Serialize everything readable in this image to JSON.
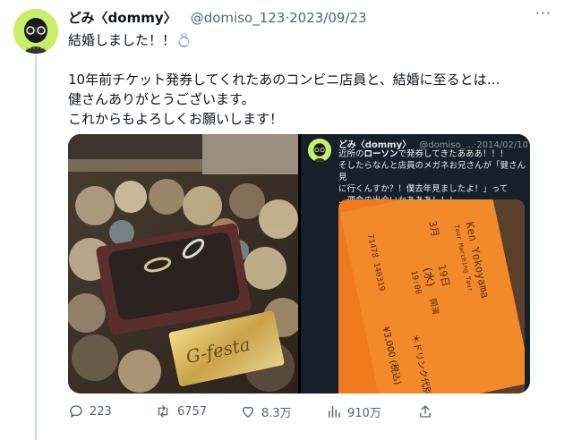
{
  "tweet": {
    "display_name": "どみ〈dommy〉",
    "handle": "@domiso_123",
    "separator": "·",
    "date": "2023/09/23",
    "more": "···",
    "text_lines": [
      "結婚しました！！💍",
      "",
      "10年前チケット発券してくれたあのコンビニ店員と、結婚に至るとは…",
      "健さんありがとうございます。",
      "これからもよろしくお願いします！"
    ]
  },
  "media": {
    "left_photo": {
      "ring_box_label": "G-festa"
    },
    "quoted_tweet": {
      "display_name": "どみ〈dommy〉",
      "handle": "@domiso_...",
      "separator": "·",
      "date": "2014/02/10",
      "line1_prefix": "近所の",
      "line1_bold": "ローソン",
      "line1_suffix": "で発券してきたあああ！！！",
      "line2": "そしたらなんと店員のメガネお兄さんが「健さん見",
      "line3": "に行くんすか？！僕去年見ましたよ！」って",
      "line4": "…運命の出会いかあああ！！！",
      "ticket": {
        "artist": "Ken Yokoyama",
        "tour": "Tour Marching Tour",
        "month": "3月",
        "day": "19日",
        "weekday": "(水)",
        "time": "19:00",
        "open_label": "開演",
        "drink": "＊ドリンク代別",
        "number": "71478 140319",
        "price": "¥3,000 (税込)"
      }
    }
  },
  "actions": {
    "reply_count": "223",
    "retweet_count": "6757",
    "like_count": "8.3万",
    "views_count": "910万"
  }
}
